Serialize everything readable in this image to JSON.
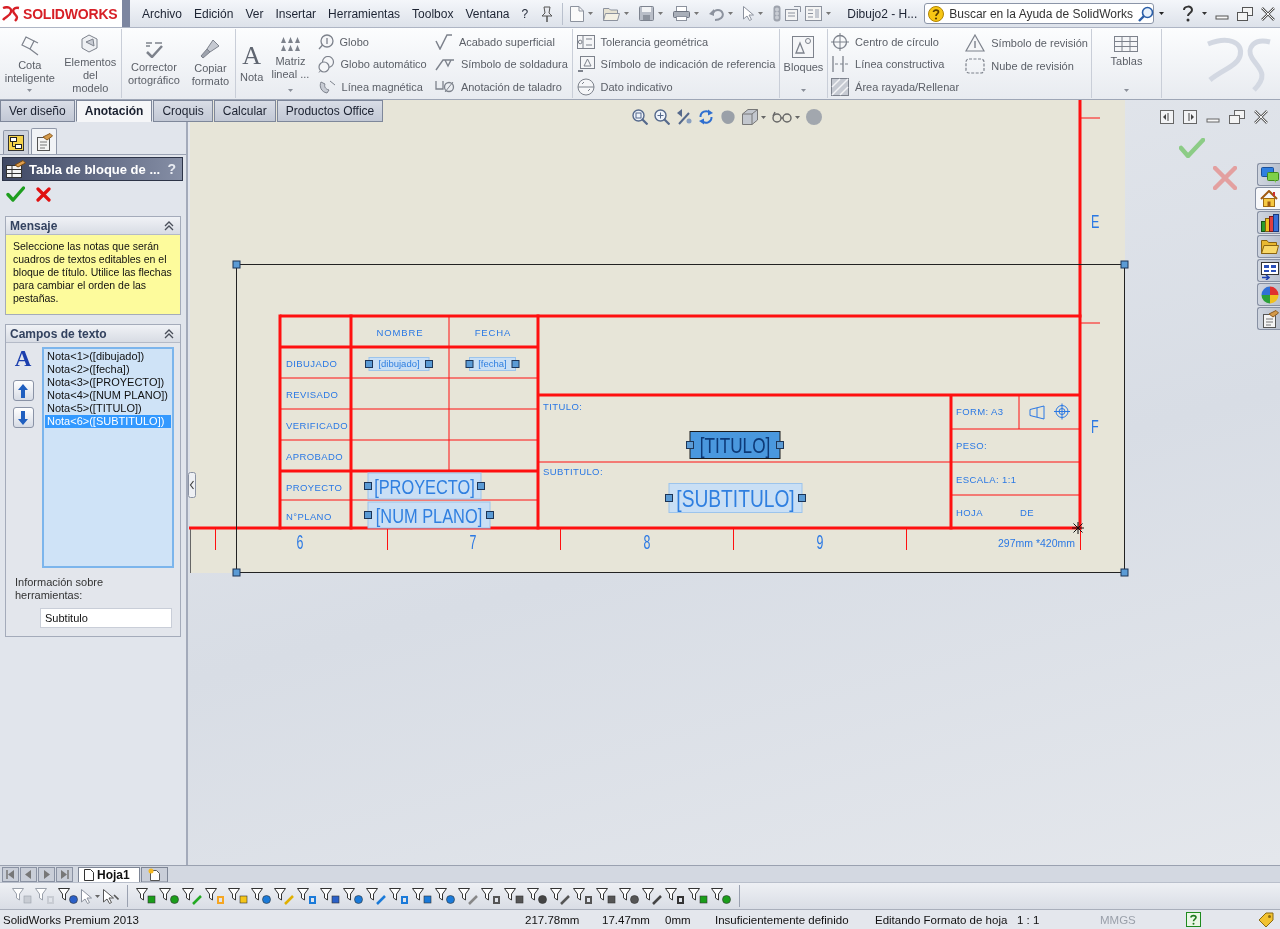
{
  "app": {
    "logo": "SOLIDWORKS",
    "menu": [
      "Archivo",
      "Edición",
      "Ver",
      "Insertar",
      "Herramientas",
      "Toolbox",
      "Ventana",
      "?"
    ],
    "document_title": "Dibujo2 - H...",
    "search": {
      "placeholder": "Buscar en la Ayuda de SolidWorks"
    }
  },
  "ribbon": {
    "groups": [
      {
        "items": [
          {
            "kind": "large",
            "label": "Cota\ninteligente",
            "dropdown": true
          },
          {
            "kind": "large",
            "label": "Elementos\ndel\nmodelo",
            "dropdown": false
          }
        ]
      },
      {
        "items": [
          {
            "kind": "large",
            "label": "Corrector\nortográfico",
            "dropdown": false
          },
          {
            "kind": "large",
            "label": "Copiar\nformato",
            "dropdown": false
          }
        ]
      },
      {
        "items": [
          {
            "kind": "large",
            "label": "Nota",
            "glyph": "A",
            "dropdown": false
          },
          {
            "kind": "large",
            "label": "Matriz\nlineal ...",
            "dropdown": true
          },
          {
            "kind": "stack",
            "items": [
              "Globo",
              "Globo automático",
              "Línea magnética"
            ]
          },
          {
            "kind": "stack",
            "items": [
              "Acabado superficial",
              "Símbolo de soldadura",
              "Anotación de taladro"
            ]
          }
        ]
      },
      {
        "items": [
          {
            "kind": "stack",
            "items": [
              "Tolerancia geométrica",
              "Símbolo de indicación de referencia",
              "Dato indicativo"
            ]
          }
        ]
      },
      {
        "items": [
          {
            "kind": "large",
            "label": "Bloques",
            "dropdown": true
          }
        ]
      },
      {
        "items": [
          {
            "kind": "stack",
            "items": [
              "Centro de círculo",
              "Línea constructiva",
              "Área rayada/Rellenar"
            ]
          },
          {
            "kind": "stack",
            "items": [
              "Símbolo de revisión",
              "Nube de revisión"
            ]
          }
        ]
      },
      {
        "items": [
          {
            "kind": "large",
            "label": "Tablas",
            "dropdown": true
          }
        ]
      }
    ]
  },
  "tabs": [
    {
      "label": "Ver diseño",
      "selected": false
    },
    {
      "label": "Anotación",
      "selected": true
    },
    {
      "label": "Croquis",
      "selected": false
    },
    {
      "label": "Calcular",
      "selected": false
    },
    {
      "label": "Productos Office",
      "selected": false
    }
  ],
  "property_manager": {
    "tabs": [
      {
        "selected": false
      },
      {
        "selected": true
      }
    ],
    "title": "Tabla de bloque de ...",
    "help": "?",
    "message": {
      "heading": "Mensaje",
      "expanded": true,
      "text": "Seleccione las notas que serán cuadros de textos editables en el bloque de título. Utilice las flechas para cambiar el orden de las pestañas."
    },
    "text_fields": {
      "heading": "Campos de texto",
      "expanded": true,
      "glyph": "A",
      "items": [
        {
          "label": "Nota<1>([dibujado])",
          "selected": false
        },
        {
          "label": "Nota<2>([fecha])",
          "selected": false
        },
        {
          "label": "Nota<3>([PROYECTO])",
          "selected": false
        },
        {
          "label": "Nota<4>([NUM PLANO])",
          "selected": false
        },
        {
          "label": "Nota<5>([TITULO])",
          "selected": false
        },
        {
          "label": "Nota<6>([SUBTITULO])",
          "selected": true
        }
      ],
      "tooltip_label": "Información sobre herramientas:",
      "tooltip_value": "Subtitulo"
    }
  },
  "drawing": {
    "zone_letters": [
      "E",
      "F"
    ],
    "zone_numbers": [
      "6",
      "7",
      "8",
      "9"
    ],
    "sheet_size": "297mm *420mm",
    "title_block": {
      "columns": [
        "NOMBRE",
        "FECHA"
      ],
      "signature_rows": [
        {
          "label": "DIBUJADO",
          "name": {
            "value": "[dibujado]",
            "highlighted": false
          },
          "date": {
            "value": "[fecha]",
            "highlighted": false
          }
        },
        {
          "label": "REVISADO"
        },
        {
          "label": "VERIFICADO"
        },
        {
          "label": "APROBADO"
        }
      ],
      "project_rows": [
        {
          "label": "PROYECTO",
          "note": {
            "value": "[PROYECTO]",
            "highlighted": false
          }
        },
        {
          "label": "N°PLANO",
          "note": {
            "value": "[NUM PLANO]",
            "highlighted": false
          }
        }
      ],
      "title": {
        "label": "TITULO:",
        "note": {
          "value": "[TITULO]",
          "highlighted": true
        }
      },
      "subtitle": {
        "label": "SUBTITULO:",
        "note": {
          "value": "[SUBTITULO]",
          "highlighted": false
        }
      },
      "format": "FORM: A3",
      "weight": "PESO:",
      "scale": "ESCALA: 1:1",
      "sheet": "HOJA",
      "sheet_of": "DE"
    }
  },
  "task_pane_tabs": [
    {
      "selected": false
    },
    {
      "selected": true
    },
    {
      "selected": false
    },
    {
      "selected": false
    },
    {
      "selected": false
    },
    {
      "selected": false
    },
    {
      "selected": false
    }
  ],
  "sheet_tabs": [
    {
      "label": "Hoja1",
      "selected": true
    }
  ],
  "status_bar": {
    "product": "SolidWorks Premium 2013",
    "x": "217.78mm",
    "y": "17.47mm",
    "z": "0mm",
    "definition": "Insuficientemente definido",
    "mode": "Editando Formato de hoja",
    "scale": "1 : 1",
    "units": "MMGS"
  }
}
